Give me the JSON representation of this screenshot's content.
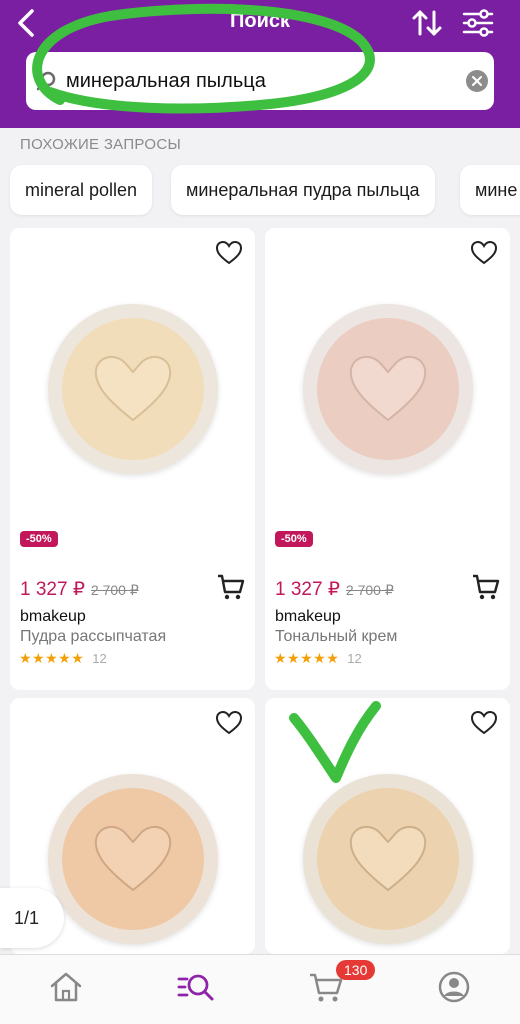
{
  "header": {
    "title": "Поиск",
    "search_value": "минеральная пыльца"
  },
  "similar": {
    "label": "ПОХОЖИЕ ЗАПРОСЫ",
    "chips": [
      "mineral pollen",
      "минеральная пудра пыльца",
      "мине"
    ]
  },
  "products": [
    {
      "badge": "-50%",
      "price": "1 327 ₽",
      "old_price": "2 700 ₽",
      "brand": "bmakeup",
      "name": "Пудра рассыпчатая",
      "stars": "★★★★★",
      "reviews": "12"
    },
    {
      "badge": "-50%",
      "price": "1 327 ₽",
      "old_price": "2 700 ₽",
      "brand": "bmakeup",
      "name": "Тональный крем",
      "stars": "★★★★★",
      "reviews": "12"
    }
  ],
  "pagination": "1/1",
  "nav": {
    "cart_count": "130"
  },
  "colors": {
    "accent": "#7b1fa2",
    "price": "#c2185b",
    "badge": "#c2185b",
    "star": "#f2a007",
    "annotation": "#3fbf3f"
  }
}
